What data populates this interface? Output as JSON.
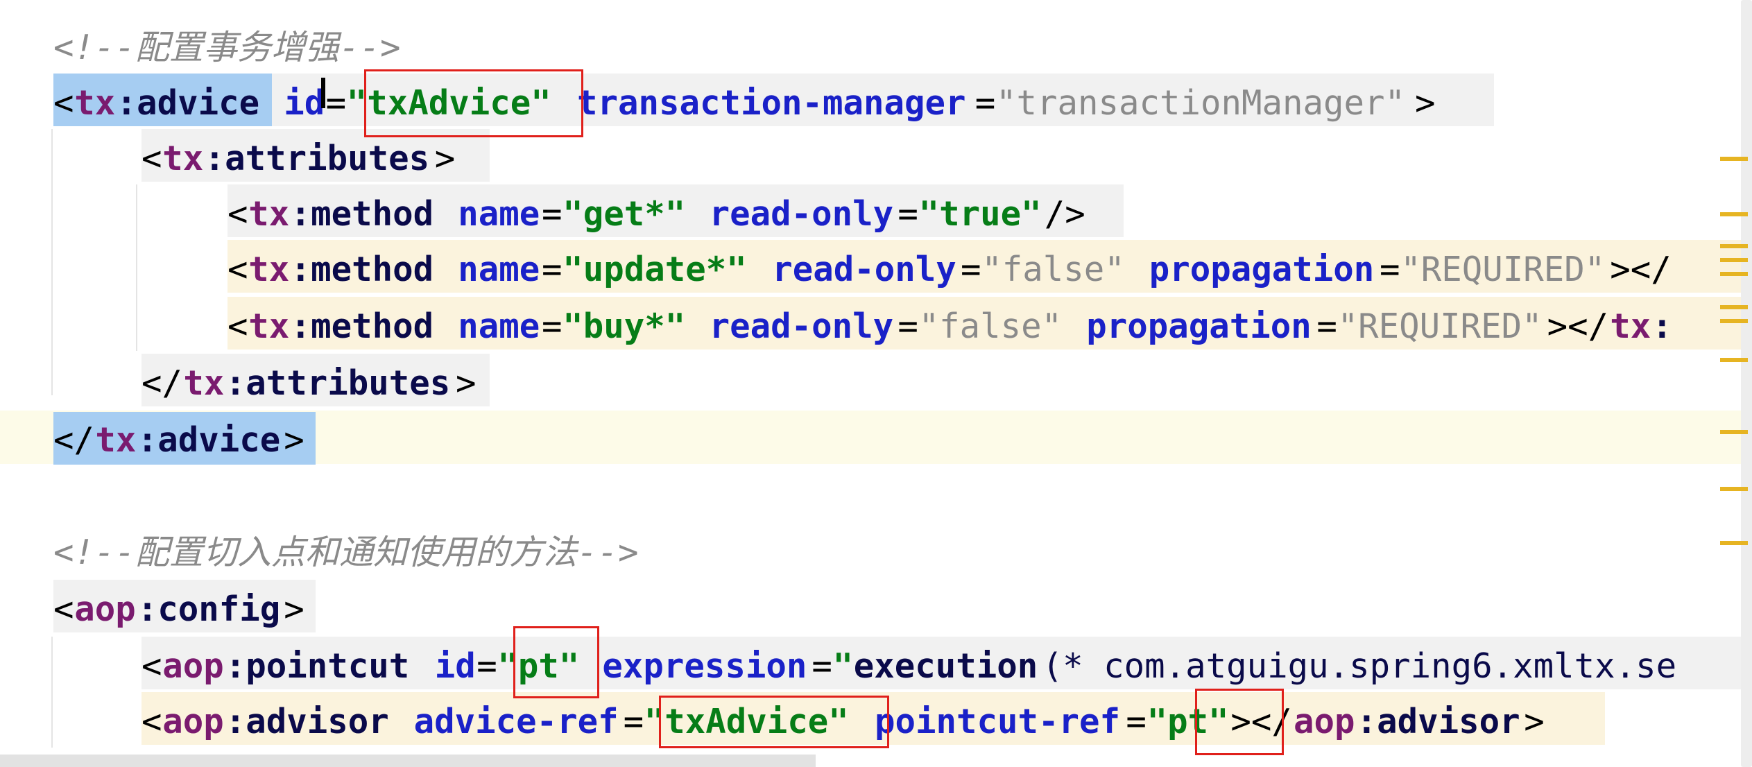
{
  "colors": {
    "selection": "#a6cdf2",
    "tag_background": "#f1f1f1",
    "attr_highlight": "#fbf3dd",
    "current_line": "#fdfbe8",
    "annotation_box": "#e0201b",
    "marker": "#e6b422"
  },
  "lines": [
    {
      "name": "comment-tx-advice",
      "tokens": [
        {
          "t": "<!--配置事务增强-->",
          "k": "comment"
        }
      ]
    },
    {
      "name": "tx-advice-open",
      "tokens": [
        {
          "t": "<",
          "k": "bracket"
        },
        {
          "t": "tx",
          "k": "ns"
        },
        {
          "t": ":advice",
          "k": "tag"
        },
        {
          "t": " ",
          "k": "plain"
        },
        {
          "t": "id",
          "k": "attr"
        },
        {
          "t": "=",
          "k": "eq"
        },
        {
          "t": "\"txAdvice\"",
          "k": "val"
        },
        {
          "t": " ",
          "k": "plain"
        },
        {
          "t": "transaction-manager",
          "k": "attr"
        },
        {
          "t": "=",
          "k": "eq"
        },
        {
          "t": "\"transactionManager\"",
          "k": "val-gray"
        },
        {
          "t": ">",
          "k": "bracket"
        }
      ]
    },
    {
      "name": "tx-attributes-open",
      "tokens": [
        {
          "t": "<",
          "k": "bracket"
        },
        {
          "t": "tx",
          "k": "ns"
        },
        {
          "t": ":attributes",
          "k": "tag"
        },
        {
          "t": ">",
          "k": "bracket"
        }
      ]
    },
    {
      "name": "tx-method-get",
      "tokens": [
        {
          "t": "<",
          "k": "bracket"
        },
        {
          "t": "tx",
          "k": "ns"
        },
        {
          "t": ":method",
          "k": "tag"
        },
        {
          "t": " ",
          "k": "plain"
        },
        {
          "t": "name",
          "k": "attr"
        },
        {
          "t": "=",
          "k": "eq"
        },
        {
          "t": "\"get*\"",
          "k": "val"
        },
        {
          "t": " ",
          "k": "plain"
        },
        {
          "t": "read-only",
          "k": "attr"
        },
        {
          "t": "=",
          "k": "eq"
        },
        {
          "t": "\"true\"",
          "k": "val"
        },
        {
          "t": "/>",
          "k": "bracket"
        }
      ]
    },
    {
      "name": "tx-method-update",
      "tokens": [
        {
          "t": "<",
          "k": "bracket"
        },
        {
          "t": "tx",
          "k": "ns"
        },
        {
          "t": ":method",
          "k": "tag"
        },
        {
          "t": " ",
          "k": "plain"
        },
        {
          "t": "name",
          "k": "attr"
        },
        {
          "t": "=",
          "k": "eq"
        },
        {
          "t": "\"update*\"",
          "k": "val"
        },
        {
          "t": " ",
          "k": "plain"
        },
        {
          "t": "read-only",
          "k": "attr"
        },
        {
          "t": "=",
          "k": "eq"
        },
        {
          "t": "\"false\"",
          "k": "val-gray"
        },
        {
          "t": " ",
          "k": "plain"
        },
        {
          "t": "propagation",
          "k": "attr"
        },
        {
          "t": "=",
          "k": "eq"
        },
        {
          "t": "\"REQUIRED\"",
          "k": "val-gray"
        },
        {
          "t": "></",
          "k": "bracket"
        }
      ]
    },
    {
      "name": "tx-method-buy",
      "tokens": [
        {
          "t": "<",
          "k": "bracket"
        },
        {
          "t": "tx",
          "k": "ns"
        },
        {
          "t": ":method",
          "k": "tag"
        },
        {
          "t": " ",
          "k": "plain"
        },
        {
          "t": "name",
          "k": "attr"
        },
        {
          "t": "=",
          "k": "eq"
        },
        {
          "t": "\"buy*\"",
          "k": "val"
        },
        {
          "t": " ",
          "k": "plain"
        },
        {
          "t": "read-only",
          "k": "attr"
        },
        {
          "t": "=",
          "k": "eq"
        },
        {
          "t": "\"false\"",
          "k": "val-gray"
        },
        {
          "t": " ",
          "k": "plain"
        },
        {
          "t": "propagation",
          "k": "attr"
        },
        {
          "t": "=",
          "k": "eq"
        },
        {
          "t": "\"REQUIRED\"",
          "k": "val-gray"
        },
        {
          "t": "></",
          "k": "bracket"
        },
        {
          "t": "tx",
          "k": "ns"
        },
        {
          "t": ":",
          "k": "tag"
        }
      ]
    },
    {
      "name": "tx-attributes-close",
      "tokens": [
        {
          "t": "</",
          "k": "bracket"
        },
        {
          "t": "tx",
          "k": "ns"
        },
        {
          "t": ":attributes",
          "k": "tag"
        },
        {
          "t": ">",
          "k": "bracket"
        }
      ]
    },
    {
      "name": "tx-advice-close",
      "tokens": [
        {
          "t": "</",
          "k": "bracket"
        },
        {
          "t": "tx",
          "k": "ns"
        },
        {
          "t": ":advice",
          "k": "tag"
        },
        {
          "t": ">",
          "k": "bracket"
        }
      ]
    },
    {
      "name": "blank-line",
      "tokens": []
    },
    {
      "name": "comment-aop",
      "tokens": [
        {
          "t": "<!--配置切入点和通知使用的方法-->",
          "k": "comment"
        }
      ]
    },
    {
      "name": "aop-config-open",
      "tokens": [
        {
          "t": "<",
          "k": "bracket"
        },
        {
          "t": "aop",
          "k": "ns"
        },
        {
          "t": ":config",
          "k": "tag"
        },
        {
          "t": ">",
          "k": "bracket"
        }
      ]
    },
    {
      "name": "aop-pointcut",
      "tokens": [
        {
          "t": "<",
          "k": "bracket"
        },
        {
          "t": "aop",
          "k": "ns"
        },
        {
          "t": ":pointcut",
          "k": "tag"
        },
        {
          "t": " ",
          "k": "plain"
        },
        {
          "t": "id",
          "k": "attr"
        },
        {
          "t": "=",
          "k": "eq"
        },
        {
          "t": "\"pt\"",
          "k": "val"
        },
        {
          "t": " ",
          "k": "plain"
        },
        {
          "t": "expression",
          "k": "attr"
        },
        {
          "t": "=",
          "k": "eq"
        },
        {
          "t": "\"",
          "k": "val"
        },
        {
          "t": "execution",
          "k": "tag"
        },
        {
          "t": "(* com.atguigu.spring6.xmltx.se",
          "k": "text"
        }
      ]
    },
    {
      "name": "aop-advisor",
      "tokens": [
        {
          "t": "<",
          "k": "bracket"
        },
        {
          "t": "aop",
          "k": "ns"
        },
        {
          "t": ":advisor",
          "k": "tag"
        },
        {
          "t": " ",
          "k": "plain"
        },
        {
          "t": "advice-ref",
          "k": "attr"
        },
        {
          "t": "=",
          "k": "eq"
        },
        {
          "t": "\"txAdvice\"",
          "k": "val"
        },
        {
          "t": " ",
          "k": "plain"
        },
        {
          "t": "pointcut-ref",
          "k": "attr"
        },
        {
          "t": "=",
          "k": "eq"
        },
        {
          "t": "\"pt\"",
          "k": "val"
        },
        {
          "t": "></",
          "k": "bracket"
        },
        {
          "t": "aop",
          "k": "ns"
        },
        {
          "t": ":advisor",
          "k": "tag"
        },
        {
          "t": ">",
          "k": "bracket"
        }
      ]
    }
  ]
}
